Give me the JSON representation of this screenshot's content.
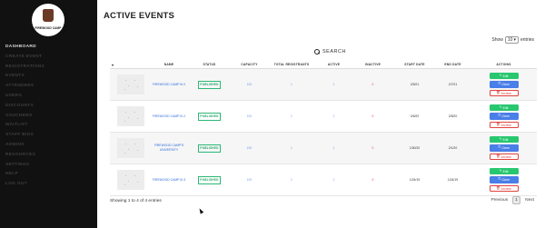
{
  "logo": {
    "text": "FIREWOOD CAMP"
  },
  "sidebar": {
    "items": [
      {
        "label": "DASHBOARD"
      },
      {
        "label": "CREATE EVENT"
      },
      {
        "label": "REGISTRATIONS"
      },
      {
        "label": "EVENTS"
      },
      {
        "label": "ATTENDEES"
      },
      {
        "label": "USERS"
      },
      {
        "label": "DISCOUNTS"
      },
      {
        "label": "VOUCHERS"
      },
      {
        "label": "WAITLIST"
      },
      {
        "label": "STAFF BIOS"
      },
      {
        "label": "ADMINS"
      },
      {
        "label": "RESOURCES"
      },
      {
        "label": "SETTINGS"
      },
      {
        "label": "HELP"
      },
      {
        "label": "LOG OUT"
      }
    ]
  },
  "page": {
    "title": "ACTIVE EVENTS"
  },
  "show_entries": {
    "prefix": "Show",
    "value": "10",
    "suffix": "entries"
  },
  "search": {
    "label": "SEARCH"
  },
  "table": {
    "headers": [
      "NAME",
      "STATUS",
      "CAPACITY",
      "TOTAL REGISTRANTS",
      "ACTIVE",
      "INACTIVE",
      "START DATE",
      "END DATE",
      "ACTIONS"
    ],
    "rows": [
      {
        "name": "FIREWOOD CAMP III.0",
        "status": "PUBLISHED",
        "capacity": "100",
        "total": "1",
        "active": "1",
        "inactive": "0",
        "start": "2/5/21",
        "end": "2/7/21"
      },
      {
        "name": "FIREWOOD CAMP III.2",
        "status": "PUBLISHED",
        "capacity": "100",
        "total": "1",
        "active": "1",
        "inactive": "0",
        "start": "2/6/20",
        "end": "2/8/20"
      },
      {
        "name": "FIREWOOD CAMP'S UNIVERSITY",
        "status": "PUBLISHED",
        "capacity": "150",
        "total": "1",
        "active": "1",
        "inactive": "0",
        "start": "1/30/20",
        "end": "2/1/20"
      },
      {
        "name": "FIREWOOD CAMP III.3",
        "status": "PUBLISHED",
        "capacity": "100",
        "total": "1",
        "active": "1",
        "inactive": "0",
        "start": "1/24/19",
        "end": "1/24/19"
      }
    ],
    "actions": {
      "edit": "Edit",
      "clone": "Clone",
      "archive": "Archive"
    }
  },
  "footer": {
    "info": "Showing 1 to 4 of 4 entries"
  },
  "pagination": {
    "previous": "Previous",
    "page": "1",
    "next": "Next"
  },
  "colors": {
    "sidebar": "#111111",
    "published": "#2cb877",
    "edit": "#28c76f",
    "clone": "#4a7ee8",
    "archive": "#e0433d",
    "link": "#2d6cdf"
  }
}
